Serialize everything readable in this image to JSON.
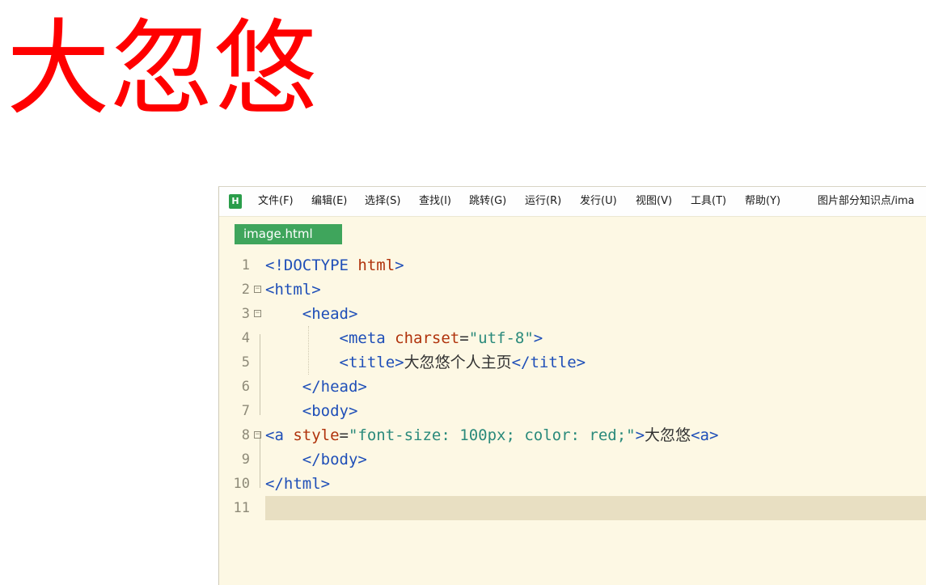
{
  "page": {
    "big_text": "大忽悠",
    "big_text_color": "#ff0000"
  },
  "editor": {
    "logo": "H",
    "menu": [
      {
        "label": "文件(F)"
      },
      {
        "label": "编辑(E)"
      },
      {
        "label": "选择(S)"
      },
      {
        "label": "查找(I)"
      },
      {
        "label": "跳转(G)"
      },
      {
        "label": "运行(R)"
      },
      {
        "label": "发行(U)"
      },
      {
        "label": "视图(V)"
      },
      {
        "label": "工具(T)"
      },
      {
        "label": "帮助(Y)"
      }
    ],
    "file_path": "图片部分知识点/ima",
    "tab_label": "image.html",
    "tab_color": "#3fa55c",
    "current_line": 11,
    "lines": [
      {
        "n": "1",
        "tokens": [
          [
            "tag",
            "<!DOCTYPE "
          ],
          [
            "attr",
            "html"
          ],
          [
            "tag",
            ">"
          ]
        ]
      },
      {
        "n": "2",
        "tokens": [
          [
            "tag",
            "<html>"
          ]
        ]
      },
      {
        "n": "3",
        "tokens": [
          [
            "text",
            "    "
          ],
          [
            "tag",
            "<head>"
          ]
        ]
      },
      {
        "n": "4",
        "tokens": [
          [
            "text",
            "        "
          ],
          [
            "tag",
            "<meta "
          ],
          [
            "attr",
            "charset"
          ],
          [
            "text",
            "="
          ],
          [
            "str",
            "\"utf-8\""
          ],
          [
            "tag",
            ">"
          ]
        ]
      },
      {
        "n": "5",
        "tokens": [
          [
            "text",
            "        "
          ],
          [
            "tag",
            "<title>"
          ],
          [
            "text",
            "大忽悠个人主页"
          ],
          [
            "tag",
            "</title>"
          ]
        ]
      },
      {
        "n": "6",
        "tokens": [
          [
            "text",
            "    "
          ],
          [
            "tag",
            "</head>"
          ]
        ]
      },
      {
        "n": "7",
        "tokens": [
          [
            "text",
            "    "
          ],
          [
            "tag",
            "<body>"
          ]
        ]
      },
      {
        "n": "8",
        "tokens": [
          [
            "tag",
            "<a "
          ],
          [
            "attr",
            "style"
          ],
          [
            "text",
            "="
          ],
          [
            "str",
            "\"font-size: 100px; color: red;\""
          ],
          [
            "tag",
            ">"
          ],
          [
            "text",
            "大忽悠"
          ],
          [
            "tag",
            "<a>"
          ]
        ]
      },
      {
        "n": "9",
        "tokens": [
          [
            "text",
            "    "
          ],
          [
            "tag",
            "</body>"
          ]
        ]
      },
      {
        "n": "10",
        "tokens": [
          [
            "tag",
            "</html>"
          ]
        ]
      },
      {
        "n": "11",
        "tokens": []
      }
    ]
  }
}
